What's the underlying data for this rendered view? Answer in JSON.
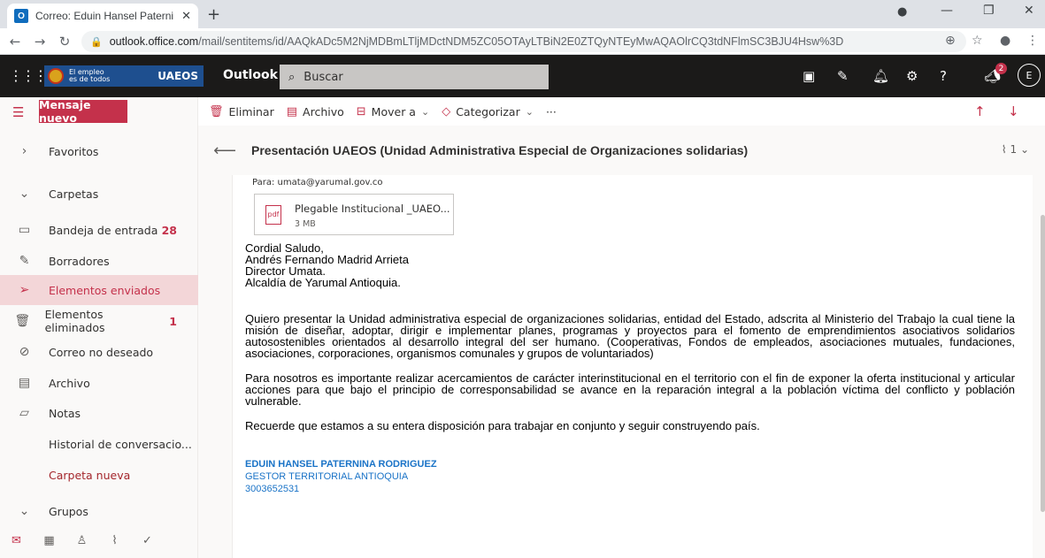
{
  "browser": {
    "tab_title": "Correo: Eduin Hansel Paternina R",
    "tab_favicon": "O",
    "url_domain": "outlook.office.com",
    "url_path": "/mail/sentitems/id/AAQkADc5M2NjMDBmLTljMDctNDM5ZC05OTAyLTBiN2E0ZTQyNTEyMwAQAOlrCQ3tdNFlmSC3BJU4Hsw%3D"
  },
  "header": {
    "org_line1": "El empleo",
    "org_line2": "es de todos",
    "org_name": "UAEOS",
    "app_name": "Outlook",
    "search_placeholder": "Buscar",
    "notification_count": "2",
    "avatar_initial": "E"
  },
  "leftpane": {
    "new_message": "Mensaje nuevo",
    "favorites": "Favoritos",
    "folders": "Carpetas",
    "items": [
      {
        "label": "Bandeja de entrada",
        "count": "28"
      },
      {
        "label": "Borradores",
        "count": ""
      },
      {
        "label": "Elementos enviados",
        "count": ""
      },
      {
        "label": "Elementos eliminados",
        "count": "1"
      },
      {
        "label": "Correo no deseado",
        "count": ""
      },
      {
        "label": "Archivo",
        "count": ""
      },
      {
        "label": "Notas",
        "count": ""
      },
      {
        "label": "Historial de conversacio...",
        "count": ""
      },
      {
        "label": "Carpeta nueva",
        "count": ""
      }
    ],
    "groups": "Grupos"
  },
  "commands": {
    "delete": "Eliminar",
    "archive": "Archivo",
    "move": "Mover a",
    "categorize": "Categorizar",
    "more": "···"
  },
  "message": {
    "subject": "Presentación UAEOS (Unidad Administrativa Especial de Organizaciones solidarias)",
    "attachment_count": "1",
    "to": "Para: umata@yarumal.gov.co",
    "attachment_name": "Plegable Institucional _UAEO...",
    "attachment_size": "3 MB",
    "greeting": [
      "Cordial Saludo,",
      "Andrés Fernando Madrid Arrieta",
      "Director Umata.",
      "Alcaldía de Yarumal Antioquia."
    ],
    "paragraph1": "Quiero presentar la Unidad administrativa especial de organizaciones solidarias, entidad del Estado, adscrita al Ministerio del Trabajo la cual tiene la misión de diseñar, adoptar, dirigir e implementar planes, programas y proyectos para el fomento de emprendimientos asociativos solidarios autosostenibles orientados al desarrollo integral del ser humano. (Cooperativas, Fondos de empleados, asociaciones mutuales, fundaciones, asociaciones, corporaciones, organismos comunales y grupos de voluntariados)",
    "paragraph2": "Para nosotros es importante realizar acercamientos de carácter interinstitucional en el territorio con el fin de exponer la oferta institucional y articular acciones para que bajo el principio de corresponsabilidad se avance en la reparación integral a la población víctima del conflicto y población vulnerable.",
    "paragraph3": "Recuerde que estamos a su entera disposición para trabajar en conjunto y seguir construyendo país.",
    "sig_name": "EDUIN HANSEL PATERNINA RODRIGUEZ",
    "sig_title": "GESTOR TERRITORIAL ANTIOQUIA",
    "sig_phone": "3003652531"
  }
}
